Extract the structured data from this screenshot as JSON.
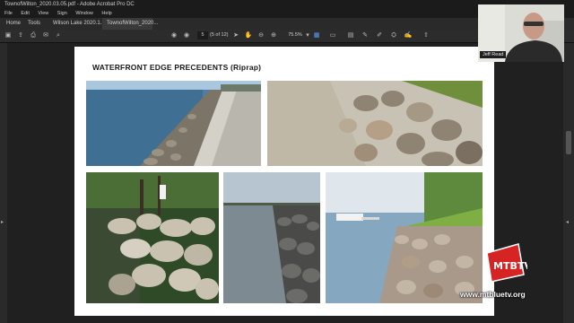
{
  "window": {
    "title": "TownofWilton_2020.03.05.pdf - Adobe Acrobat Pro DC"
  },
  "menu": {
    "items": [
      "File",
      "Edit",
      "View",
      "Sign",
      "Window",
      "Help"
    ]
  },
  "tabs": {
    "home": "Home",
    "tools": "Tools",
    "doc1": "Wilson Lake 2020.1...",
    "doc2": "TownofWilton_2020..."
  },
  "toolbar": {
    "page_current": "5",
    "page_total": "(5 of 12)",
    "zoom": "75.5%"
  },
  "slide": {
    "heading": "WATERFRONT EDGE PRECEDENTS (Riprap)"
  },
  "webcam": {
    "name": "Jeff Read"
  },
  "watermark": {
    "logo_text": "MTBTV",
    "url": "www.mtbluetv.org"
  },
  "colors": {
    "background": "#202020",
    "accent": "#5aa0ff",
    "logo_red": "#d62424"
  }
}
